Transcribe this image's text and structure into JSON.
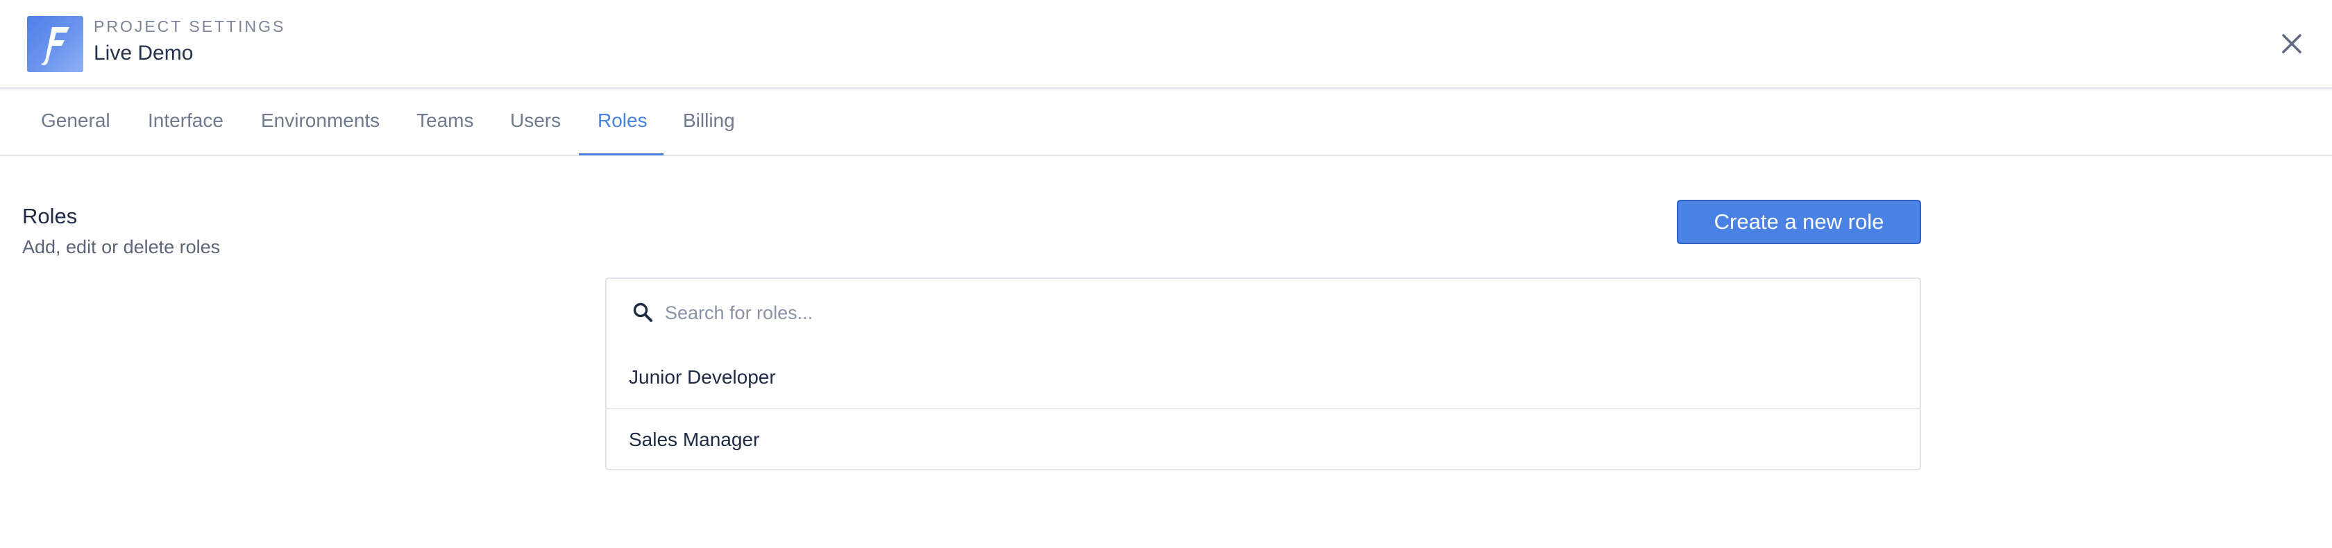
{
  "header": {
    "label": "PROJECT SETTINGS",
    "project_name": "Live Demo",
    "logo_letter": "F",
    "logo_icon": "logo-f-icon",
    "close_icon": "close-icon"
  },
  "tabs": [
    {
      "label": "General",
      "active": false
    },
    {
      "label": "Interface",
      "active": false
    },
    {
      "label": "Environments",
      "active": false
    },
    {
      "label": "Teams",
      "active": false
    },
    {
      "label": "Users",
      "active": false
    },
    {
      "label": "Roles",
      "active": true
    },
    {
      "label": "Billing",
      "active": false
    }
  ],
  "section": {
    "title": "Roles",
    "subtitle": "Add, edit or delete roles"
  },
  "actions": {
    "create_label": "Create a new role"
  },
  "search": {
    "placeholder": "Search for roles...",
    "value": "",
    "icon": "search-icon"
  },
  "roles": [
    {
      "name": "Junior Developer"
    },
    {
      "name": "Sales Manager"
    }
  ],
  "colors": {
    "accent": "#4a82e4",
    "text": "#1f2b44",
    "muted": "#6f7a8c",
    "border": "#e1e4e9"
  }
}
